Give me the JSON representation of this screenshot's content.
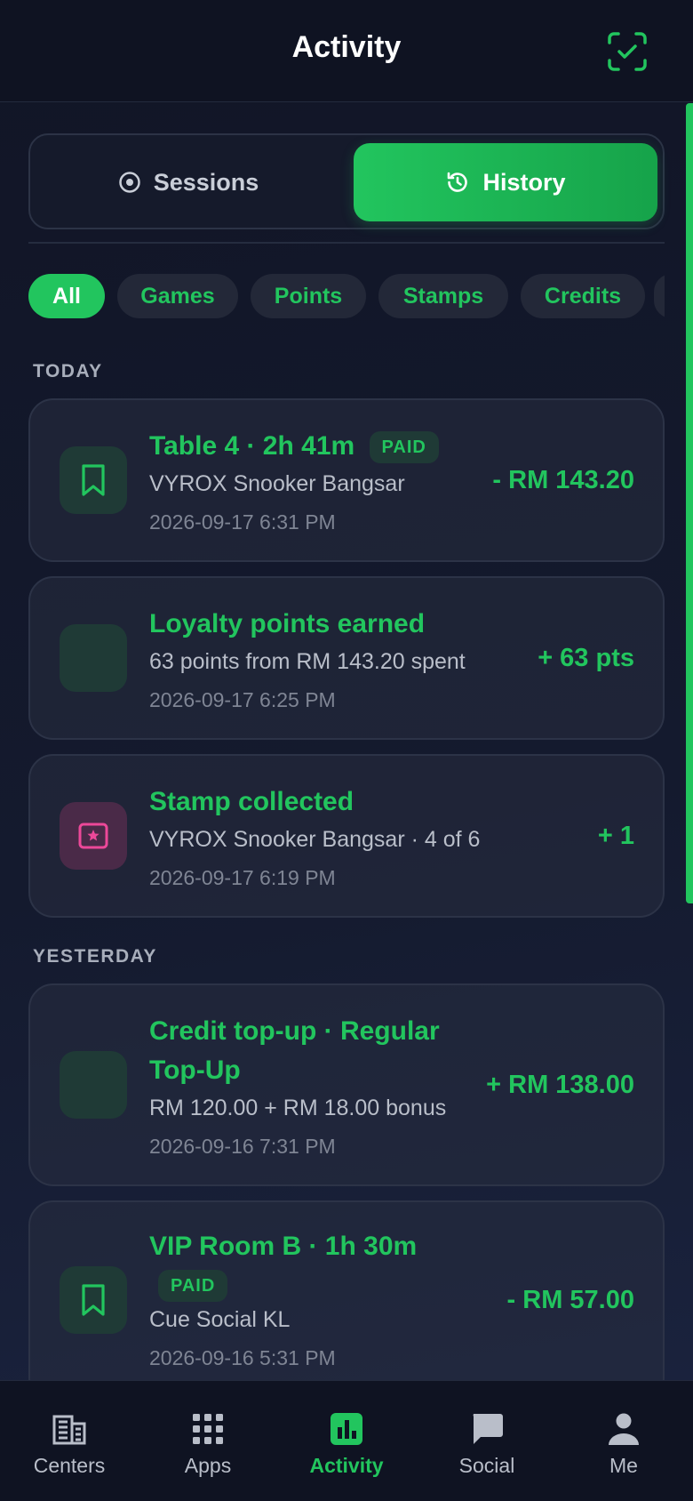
{
  "header": {
    "title": "Activity",
    "scan_icon": "scan-check-icon"
  },
  "segments": {
    "sessions": "Sessions",
    "history": "History",
    "active": "history"
  },
  "filters": [
    "All",
    "Games",
    "Points",
    "Stamps",
    "Credits"
  ],
  "sections": {
    "today": {
      "label": "TODAY",
      "items": [
        {
          "title": "Table 4 · 2h 41m",
          "badge": "PAID",
          "subtitle": "VYROX Snooker Bangsar",
          "time": "2026-09-17 6:31 PM",
          "amount": "- RM 143.20",
          "icon": "bookmark-icon"
        },
        {
          "title": "Loyalty points earned",
          "subtitle": "63 points from RM 143.20 spent",
          "time": "2026-09-17 6:25 PM",
          "amount": "+ 63 pts",
          "icon": "points-icon"
        },
        {
          "title": "Stamp collected",
          "subtitle": "VYROX Snooker Bangsar · 4 of 6",
          "time": "2026-09-17 6:19 PM",
          "amount": "+ 1",
          "icon": "stamp-star-icon"
        }
      ]
    },
    "yesterday": {
      "label": "YESTERDAY",
      "items": [
        {
          "title_line1": "Credit top-up · Regular",
          "title_line2": "Top-Up",
          "subtitle": "RM 120.00 + RM 18.00 bonus",
          "time": "2026-09-16 7:31 PM",
          "amount": "+ RM 138.00",
          "icon": "credit-icon"
        },
        {
          "title": "VIP Room B · 1h 30m",
          "badge": "PAID",
          "subtitle": "Cue Social KL",
          "time": "2026-09-16 5:31 PM",
          "amount": "- RM 57.00",
          "icon": "bookmark-icon"
        }
      ]
    }
  },
  "nav": [
    {
      "label": "Centers",
      "icon": "building-icon"
    },
    {
      "label": "Apps",
      "icon": "grid-icon"
    },
    {
      "label": "Activity",
      "icon": "bar-chart-icon",
      "active": true
    },
    {
      "label": "Social",
      "icon": "chat-icon"
    },
    {
      "label": "Me",
      "icon": "user-icon"
    }
  ],
  "colors": {
    "accent": "#22c55e",
    "background": "#111526",
    "card": "#282d40",
    "stamp_pink": "#ec4899"
  }
}
